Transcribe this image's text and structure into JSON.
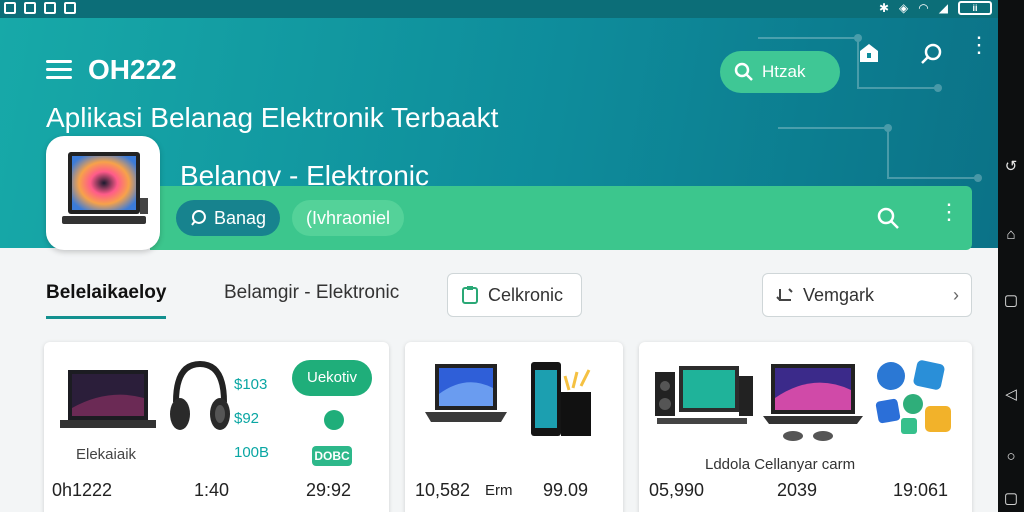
{
  "app": {
    "title": "OH222",
    "subtitle": "Aplikasi Belanag Elektronik Terbaakt"
  },
  "header": {
    "search_pill_label": "Htzak",
    "category_title": "Belangy - Elektronic",
    "chips": [
      {
        "label": "Banag"
      },
      {
        "label": "(Ivhraoniel"
      }
    ]
  },
  "tabs": [
    {
      "label": "Belelaikaeloy"
    },
    {
      "label": "Belamgir  -  Elektronic"
    }
  ],
  "buttons": {
    "filter_label": "Celkronic",
    "sort_label": "Vemgark"
  },
  "cards": [
    {
      "label": "Elekaiaik",
      "badge": "Uekotiv",
      "badge_small": "DOBC",
      "prices": [
        "$103",
        "$92",
        "100B"
      ],
      "values": [
        "0h1222",
        "1:40",
        "29:92"
      ]
    },
    {
      "values": [
        "10,582",
        "Erm",
        "99.09"
      ]
    },
    {
      "label": "Lddola Cellanyar carm",
      "values": [
        "05,990",
        "2039",
        "19:061"
      ]
    }
  ],
  "colors": {
    "hero_start": "#17a9a8",
    "hero_end": "#0b7287",
    "accent_green": "#3cc68d",
    "chip_teal": "#17838e",
    "tab_underline": "#12908f"
  },
  "status_bar": {
    "battery_label": "ii"
  }
}
